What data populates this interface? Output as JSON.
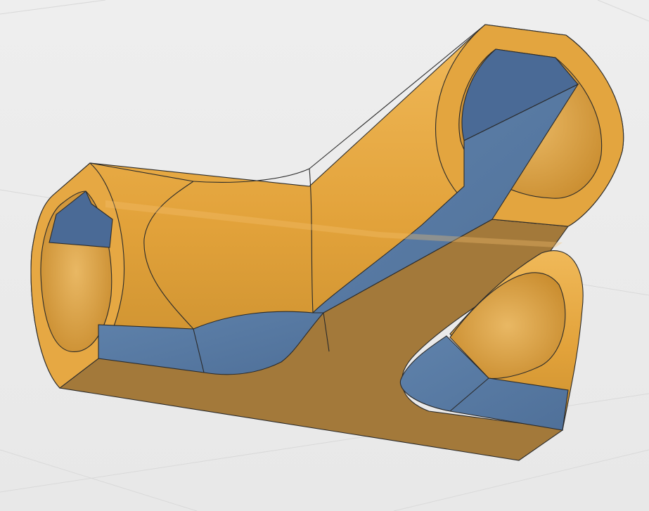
{
  "viewport": {
    "background": "#ebebeb",
    "grid_color": "#d9d9d9",
    "grid_visible": true
  },
  "model": {
    "name": "y-pipe-fitting-section-view",
    "view": "section-cut-isometric",
    "colors": {
      "body_orange": "#e0a33d",
      "body_orange_light": "#eab45c",
      "body_orange_dark": "#b8842f",
      "cut_face_brown": "#a3793a",
      "section_blue": "#5a7da6",
      "section_blue_dark": "#4a6a96",
      "edge_line": "#2a2a2a"
    }
  }
}
